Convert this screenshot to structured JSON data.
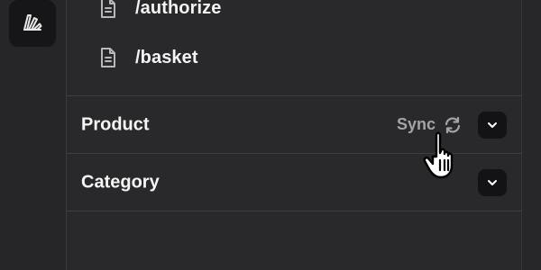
{
  "endpoints": [
    {
      "label": "/authorize",
      "icon": "file-document-icon"
    },
    {
      "label": "/basket",
      "icon": "file-document-icon"
    }
  ],
  "groups": [
    {
      "title": "Product",
      "sync_label": "Sync",
      "sync_icon": "sync-icon",
      "toggle_icon": "chevron-down-icon"
    },
    {
      "title": "Category",
      "toggle_icon": "chevron-down-icon"
    }
  ],
  "rail": {
    "logo_icon": "app-logo-icon"
  },
  "colors": {
    "background": "#272729",
    "panel": "#29292b",
    "button_dark": "#131315",
    "divider": "#3e3e42",
    "muted_text": "#a3a3a8"
  }
}
